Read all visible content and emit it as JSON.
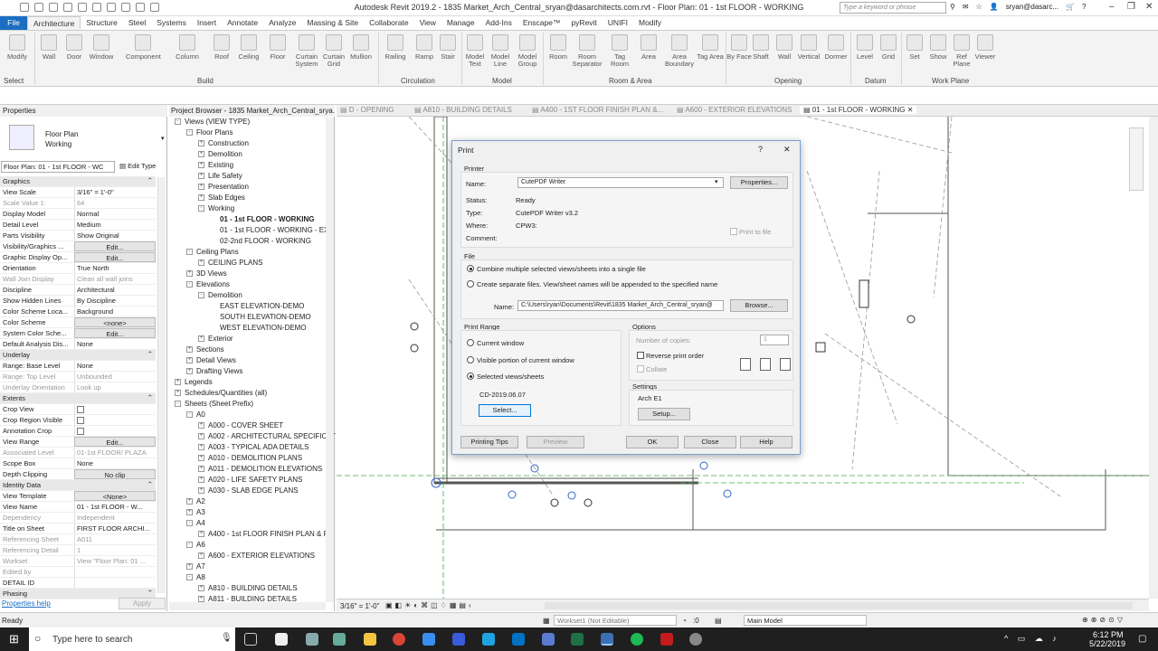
{
  "app": {
    "title": "Autodesk Revit 2019.2 - 1835 Market_Arch_Central_sryan@dasarchitects.com.rvt - Floor Plan: 01 - 1st FLOOR - WORKING",
    "search_placeholder": "Type a keyword or phrase",
    "user": "sryan@dasarc..."
  },
  "ribbon": {
    "tabs": [
      "File",
      "Architecture",
      "Structure",
      "Steel",
      "Systems",
      "Insert",
      "Annotate",
      "Analyze",
      "Massing & Site",
      "Collaborate",
      "View",
      "Manage",
      "Add-Ins",
      "Enscape™",
      "pyRevit",
      "UNIFI",
      "Modify"
    ],
    "buttons": [
      "Modify",
      "Wall",
      "Door",
      "Window",
      "Component",
      "Column",
      "Roof",
      "Ceiling",
      "Floor",
      "Curtain System",
      "Curtain Grid",
      "Mullion",
      "Railing",
      "Ramp",
      "Stair",
      "Model Text",
      "Model Line",
      "Model Group",
      "Room",
      "Room Separator",
      "Tag Room",
      "Area",
      "Area Boundary",
      "Tag Area",
      "By Face",
      "Shaft",
      "Wall",
      "Vertical",
      "Dormer",
      "Level",
      "Grid",
      "Set",
      "Show",
      "Ref Plane",
      "Viewer"
    ],
    "groups": [
      "Select",
      "Build",
      "Circulation",
      "Model",
      "Room & Area",
      "Opening",
      "Datum",
      "Work Plane"
    ]
  },
  "properties": {
    "title": "Properties",
    "type_name": "Floor Plan",
    "type_sub": "Working",
    "selector": "Floor Plan: 01 - 1st FLOOR - WC",
    "edit_type": "Edit Type",
    "rows": [
      {
        "k": "Graphics",
        "v": "",
        "sec": true
      },
      {
        "k": "View Scale",
        "v": "3/16\" = 1'-0\""
      },
      {
        "k": "Scale Value  1:",
        "v": "64",
        "dim": true
      },
      {
        "k": "Display Model",
        "v": "Normal"
      },
      {
        "k": "Detail Level",
        "v": "Medium"
      },
      {
        "k": "Parts Visibility",
        "v": "Show Original"
      },
      {
        "k": "Visibility/Graphics ...",
        "v": "Edit...",
        "btn": true
      },
      {
        "k": "Graphic Display Op...",
        "v": "Edit...",
        "btn": true
      },
      {
        "k": "Orientation",
        "v": "True North"
      },
      {
        "k": "Wall Join Display",
        "v": "Clean all wall joins",
        "dim": true
      },
      {
        "k": "Discipline",
        "v": "Architectural"
      },
      {
        "k": "Show Hidden Lines",
        "v": "By Discipline"
      },
      {
        "k": "Color Scheme Loca...",
        "v": "Background"
      },
      {
        "k": "Color Scheme",
        "v": "<none>",
        "btn": true
      },
      {
        "k": "System Color Sche...",
        "v": "Edit...",
        "btn": true
      },
      {
        "k": "Default Analysis Dis...",
        "v": "None"
      },
      {
        "k": "Underlay",
        "v": "",
        "sec": true
      },
      {
        "k": "Range: Base Level",
        "v": "None"
      },
      {
        "k": "Range: Top Level",
        "v": "Unbounded",
        "dim": true
      },
      {
        "k": "Underlay Orientation",
        "v": "Look up",
        "dim": true
      },
      {
        "k": "Extents",
        "v": "",
        "sec": true
      },
      {
        "k": "Crop View",
        "v": "",
        "chk": true
      },
      {
        "k": "Crop Region Visible",
        "v": "",
        "chk": true
      },
      {
        "k": "Annotation Crop",
        "v": "",
        "chk": true
      },
      {
        "k": "View Range",
        "v": "Edit...",
        "btn": true
      },
      {
        "k": "Associated Level",
        "v": "01-1st FLOOR/ PLAZA",
        "dim": true
      },
      {
        "k": "Scope Box",
        "v": "None"
      },
      {
        "k": "Depth Clipping",
        "v": "No clip",
        "btn": true
      },
      {
        "k": "Identity Data",
        "v": "",
        "sec": true
      },
      {
        "k": "View Template",
        "v": "<None>",
        "btn": true
      },
      {
        "k": "View Name",
        "v": "01 - 1st FLOOR - W..."
      },
      {
        "k": "Dependency",
        "v": "Independent",
        "dim": true
      },
      {
        "k": "Title on Sheet",
        "v": "FIRST FLOOR ARCHI..."
      },
      {
        "k": "Referencing Sheet",
        "v": "A011",
        "dim": true
      },
      {
        "k": "Referencing Detail",
        "v": "1",
        "dim": true
      },
      {
        "k": "Workset",
        "v": "View \"Floor Plan: 01 ...",
        "dim": true
      },
      {
        "k": "Edited by",
        "v": "",
        "dim": true
      },
      {
        "k": "DETAIL ID",
        "v": ""
      },
      {
        "k": "Phasing",
        "v": "",
        "sec": true
      }
    ],
    "help": "Properties help",
    "apply": "Apply"
  },
  "browser": {
    "title": "Project Browser - 1835 Market_Arch_Central_srya...",
    "items": [
      {
        "t": "Views (VIEW TYPE)",
        "l": 0,
        "s": "-"
      },
      {
        "t": "Floor Plans",
        "l": 1,
        "s": "-"
      },
      {
        "t": "Construction",
        "l": 2,
        "s": "+"
      },
      {
        "t": "Demolition",
        "l": 2,
        "s": "+"
      },
      {
        "t": "Existing",
        "l": 2,
        "s": "+"
      },
      {
        "t": "Life Safety",
        "l": 2,
        "s": "+"
      },
      {
        "t": "Presentation",
        "l": 2,
        "s": "+"
      },
      {
        "t": "Slab Edges",
        "l": 2,
        "s": "+"
      },
      {
        "t": "Working",
        "l": 2,
        "s": "-"
      },
      {
        "t": "01 - 1st FLOOR - WORKING",
        "l": 3,
        "s": "",
        "sel": true
      },
      {
        "t": "01 - 1st FLOOR - WORKING - EX",
        "l": 3,
        "s": ""
      },
      {
        "t": "02-2nd FLOOR - WORKING",
        "l": 3,
        "s": ""
      },
      {
        "t": "Ceiling Plans",
        "l": 1,
        "s": "-"
      },
      {
        "t": "CEILING PLANS",
        "l": 2,
        "s": "+"
      },
      {
        "t": "3D Views",
        "l": 1,
        "s": "+"
      },
      {
        "t": "Elevations",
        "l": 1,
        "s": "-"
      },
      {
        "t": "Demolition",
        "l": 2,
        "s": "-"
      },
      {
        "t": "EAST ELEVATION-DEMO",
        "l": 3,
        "s": ""
      },
      {
        "t": "SOUTH ELEVATION-DEMO",
        "l": 3,
        "s": ""
      },
      {
        "t": "WEST ELEVATION-DEMO",
        "l": 3,
        "s": ""
      },
      {
        "t": "Exterior",
        "l": 2,
        "s": "+"
      },
      {
        "t": "Sections",
        "l": 1,
        "s": "+"
      },
      {
        "t": "Detail Views",
        "l": 1,
        "s": "+"
      },
      {
        "t": "Drafting Views",
        "l": 1,
        "s": "+"
      },
      {
        "t": "Legends",
        "l": 0,
        "s": "+"
      },
      {
        "t": "Schedules/Quantities (all)",
        "l": 0,
        "s": "+"
      },
      {
        "t": "Sheets (Sheet Prefix)",
        "l": 0,
        "s": "-"
      },
      {
        "t": "A0",
        "l": 1,
        "s": "-"
      },
      {
        "t": "A000 - COVER SHEET",
        "l": 2,
        "s": "+"
      },
      {
        "t": "A002 - ARCHITECTURAL SPECIFICAT",
        "l": 2,
        "s": "+"
      },
      {
        "t": "A003 - TYPICAL ADA DETAILS",
        "l": 2,
        "s": "+"
      },
      {
        "t": "A010 - DEMOLITION PLANS",
        "l": 2,
        "s": "+"
      },
      {
        "t": "A011 - DEMOLITION ELEVATIONS",
        "l": 2,
        "s": "+"
      },
      {
        "t": "A020 - LIFE SAFETY PLANS",
        "l": 2,
        "s": "+"
      },
      {
        "t": "A030 - SLAB EDGE PLANS",
        "l": 2,
        "s": "+"
      },
      {
        "t": "A2",
        "l": 1,
        "s": "+"
      },
      {
        "t": "A3",
        "l": 1,
        "s": "+"
      },
      {
        "t": "A4",
        "l": 1,
        "s": "-"
      },
      {
        "t": "A400 - 1st FLOOR FINISH PLAN & F",
        "l": 2,
        "s": "+"
      },
      {
        "t": "A6",
        "l": 1,
        "s": "-"
      },
      {
        "t": "A600 - EXTERIOR ELEVATIONS",
        "l": 2,
        "s": "+"
      },
      {
        "t": "A7",
        "l": 1,
        "s": "+"
      },
      {
        "t": "A8",
        "l": 1,
        "s": "-"
      },
      {
        "t": "A810 - BUILDING DETAILS",
        "l": 2,
        "s": "+"
      },
      {
        "t": "A811 - BUILDING DETAILS",
        "l": 2,
        "s": "+"
      }
    ]
  },
  "viewtabs": [
    "D - OPENING",
    "A810 - BUILDING DETAILS",
    "A400 - 1ST FLOOR FINISH PLAN &...",
    "A600 - EXTERIOR ELEVATIONS",
    "01 - 1st FLOOR - WORKING"
  ],
  "dialog": {
    "title": "Print",
    "help": "?",
    "close": "✕",
    "printer_group": "Printer",
    "name_label": "Name:",
    "printer_name": "CutePDF Writer",
    "properties": "Properties...",
    "status_label": "Status:",
    "status": "Ready",
    "type_label": "Type:",
    "type": "CutePDF Writer v3.2",
    "where_label": "Where:",
    "where": "CPW3:",
    "comment_label": "Comment:",
    "print_to_file": "Print to file",
    "file_group": "File",
    "combine": "Combine multiple selected views/sheets into a single file",
    "separate": "Create separate files. View/sheet names will be appended to the specified name",
    "file_name_label": "Name:",
    "file_name": "C:\\Users\\ryan\\Documents\\Revit\\1835 Market_Arch_Central_sryan@",
    "browse": "Browse...",
    "range_group": "Print Range",
    "current": "Current window",
    "visible": "Visible portion of current window",
    "selected": "Selected views/sheets",
    "set_name": "CD-2019.06.07",
    "select": "Select...",
    "options_group": "Options",
    "copies_label": "Number of copies:",
    "copies": "1",
    "reverse": "Reverse print order",
    "collate": "Collate",
    "settings_group": "Settings",
    "settings_name": "Arch E1",
    "setup": "Setup...",
    "printing_tips": "Printing Tips",
    "preview": "Preview",
    "ok": "OK",
    "close_btn": "Close",
    "help_btn": "Help"
  },
  "viewcontrol": {
    "scale": "3/16\" = 1'-0\""
  },
  "status": {
    "left": "Ready",
    "workset": "Workset1 (Not Editable)",
    "zero": ":0",
    "model": "Main Model"
  },
  "taskbar": {
    "search": "Type here to search",
    "time": "6:12 PM",
    "date": "5/22/2019"
  },
  "colors": {
    "accent": "#1b6ec2",
    "taskbar": "#1f1f1f"
  }
}
